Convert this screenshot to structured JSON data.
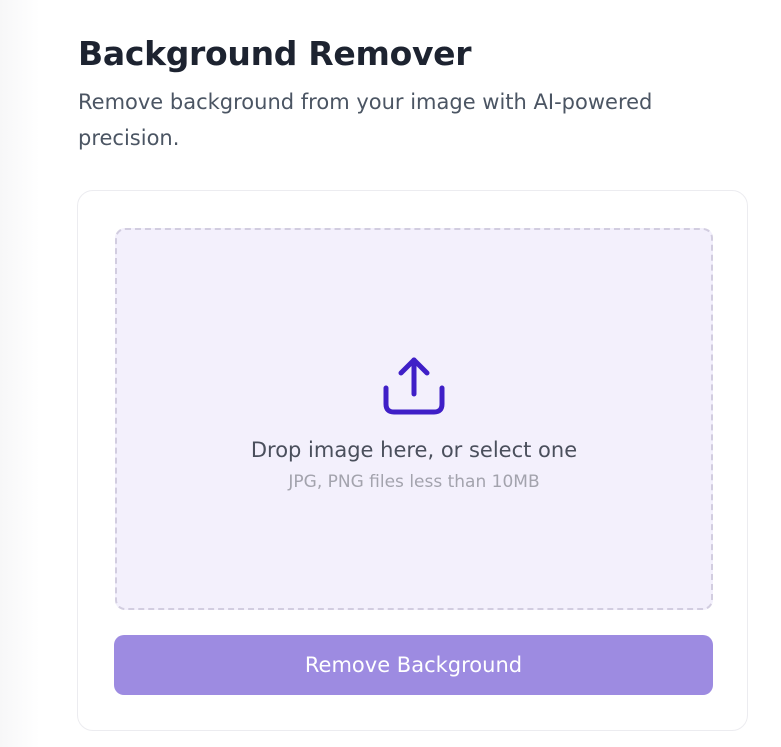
{
  "header": {
    "title": "Background Remover",
    "subtitle": "Remove background from your image with AI-powered precision."
  },
  "dropzone": {
    "icon": "upload-icon",
    "prompt": "Drop image here, or select one",
    "hint": "JPG, PNG files less than 10MB"
  },
  "actions": {
    "remove_label": "Remove Background"
  },
  "colors": {
    "accent": "#3f1fc7",
    "button": "#9d8be1",
    "dropzone_bg": "#f3f0fc",
    "dropzone_border": "#d2cde0",
    "title": "#1d2330",
    "subtitle": "#4b5563",
    "hint": "#a3a3ad"
  }
}
